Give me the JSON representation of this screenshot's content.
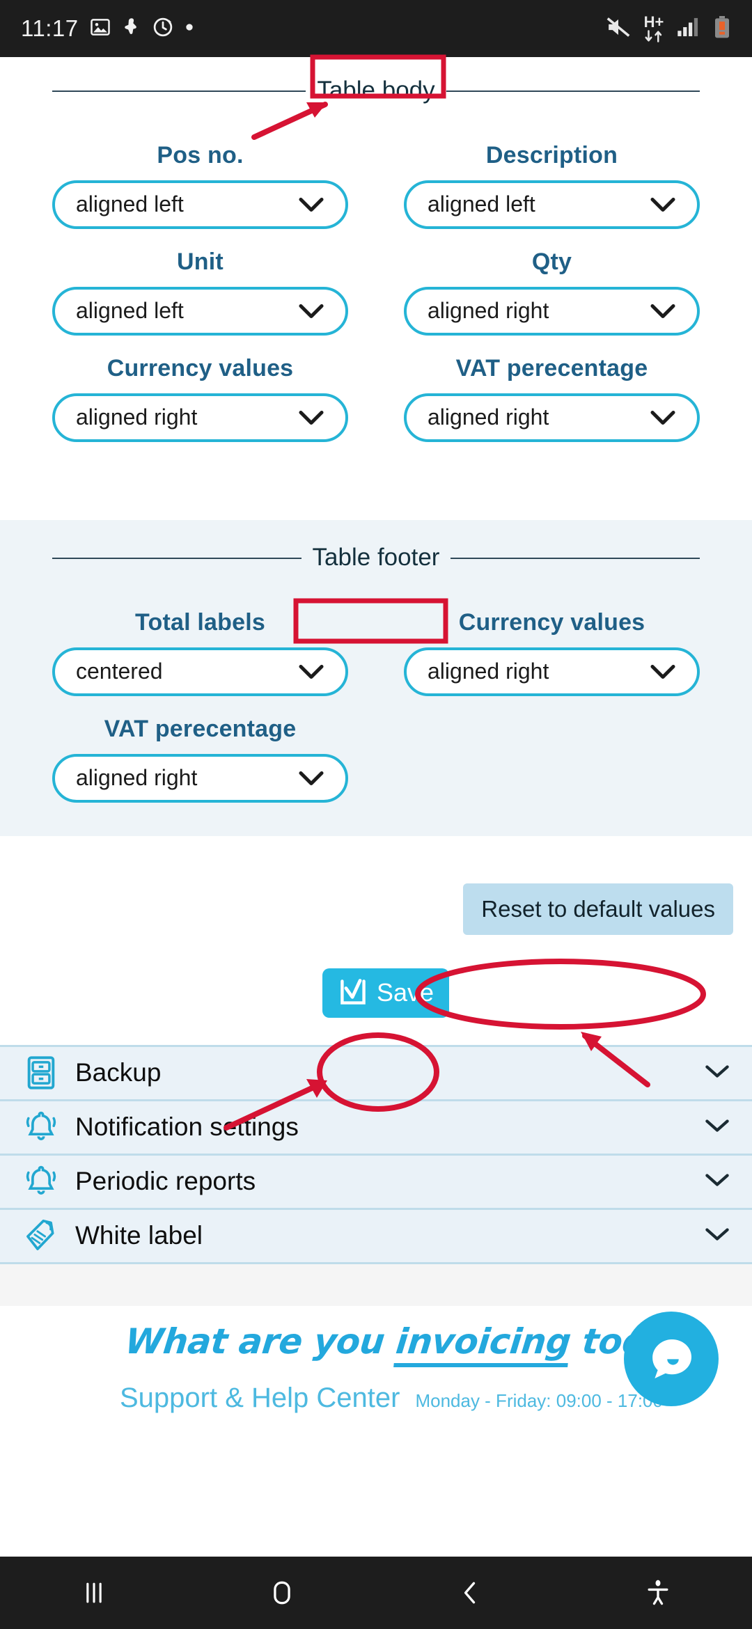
{
  "statusbar": {
    "time": "11:17",
    "left_icons": [
      "image-icon",
      "download-icon",
      "alarm-refresh-icon",
      "dot-icon"
    ],
    "right_icons": [
      "mute-icon",
      "hplus-data-icon",
      "signal-icon",
      "battery-warning-icon"
    ],
    "network_label": "H+"
  },
  "table_body": {
    "section_title": "Table body",
    "fields": [
      {
        "label": "Pos no.",
        "value": "aligned left"
      },
      {
        "label": "Description",
        "value": "aligned left"
      },
      {
        "label": "Unit",
        "value": "aligned left"
      },
      {
        "label": "Qty",
        "value": "aligned right"
      },
      {
        "label": "Currency values",
        "value": "aligned right"
      },
      {
        "label": "VAT perecentage",
        "value": "aligned right"
      }
    ],
    "options": [
      "aligned left",
      "centered",
      "aligned right"
    ]
  },
  "table_footer": {
    "section_title": "Table footer",
    "fields": [
      {
        "label": "Total labels",
        "value": "centered"
      },
      {
        "label": "Currency values",
        "value": "aligned right"
      },
      {
        "label": "VAT perecentage",
        "value": "aligned right"
      }
    ],
    "options": [
      "aligned left",
      "centered",
      "aligned right"
    ]
  },
  "actions": {
    "reset_label": "Reset to default values",
    "save_label": "Save"
  },
  "accordion": {
    "items": [
      {
        "label": "Backup",
        "icon": "server-icon"
      },
      {
        "label": "Notification settings",
        "icon": "bell-icon"
      },
      {
        "label": "Periodic reports",
        "icon": "bell-icon"
      },
      {
        "label": "White label",
        "icon": "tag-icon"
      }
    ]
  },
  "banner": {
    "headline_part1": "What are you ",
    "headline_underlined": "invoicing",
    "headline_part2": " today",
    "support_label": "Support & Help Center",
    "hours": "Monday - Friday: 09:00 - 17:00",
    "fab_icon": "chat-bubble-icon"
  },
  "navbar": {
    "recents": "recents-icon",
    "home": "home-icon",
    "back": "back-icon",
    "accessibility": "accessibility-icon"
  },
  "colors": {
    "accent_cyan": "#25b4d6",
    "label_blue": "#1f5f86",
    "panel_bg": "#eef4f8",
    "accordion_bg": "#eaf2f8",
    "annotation_red": "#d61333",
    "reset_bg": "#bdddee",
    "save_bg": "#25b9e2"
  }
}
